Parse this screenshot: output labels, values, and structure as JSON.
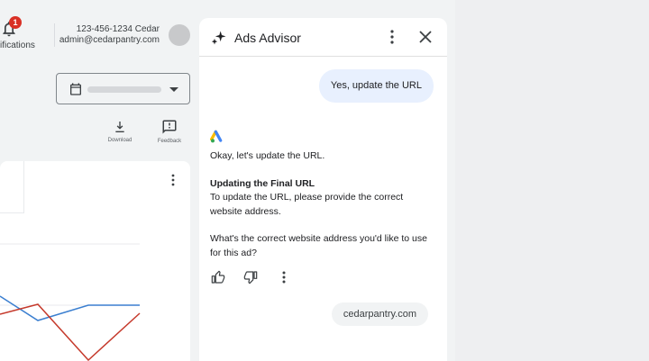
{
  "header": {
    "notifications_badge": "1",
    "notifications_label": "ifications",
    "phone_name": "123-456-1234 Cedar",
    "email": "admin@cedarpantry.com"
  },
  "toolbar": {
    "download_label": "Download",
    "feedback_label": "Feedback"
  },
  "advisor": {
    "title": "Ads Advisor",
    "user_message": "Yes, update the URL",
    "reply_intro": "Okay, let's update the URL.",
    "reply_heading": "Updating the Final URL",
    "reply_body": "To update the URL, please provide the correct website address.",
    "reply_question": "What's the correct website address you'd like to use for this ad?",
    "suggestion_chip": "cedarpantry.com"
  },
  "colors": {
    "accent_blue": "#1a73e8",
    "line_blue": "#3b7fd0",
    "line_red": "#c5392b",
    "badge_red": "#d93025",
    "user_bubble": "#e8f0fe"
  },
  "icons": [
    "bell-icon",
    "calendar-icon",
    "download-icon",
    "feedback-icon",
    "more-vert-icon",
    "sparkle-icon",
    "close-icon",
    "google-ads-logo",
    "thumb-up-icon",
    "thumb-down-icon"
  ]
}
